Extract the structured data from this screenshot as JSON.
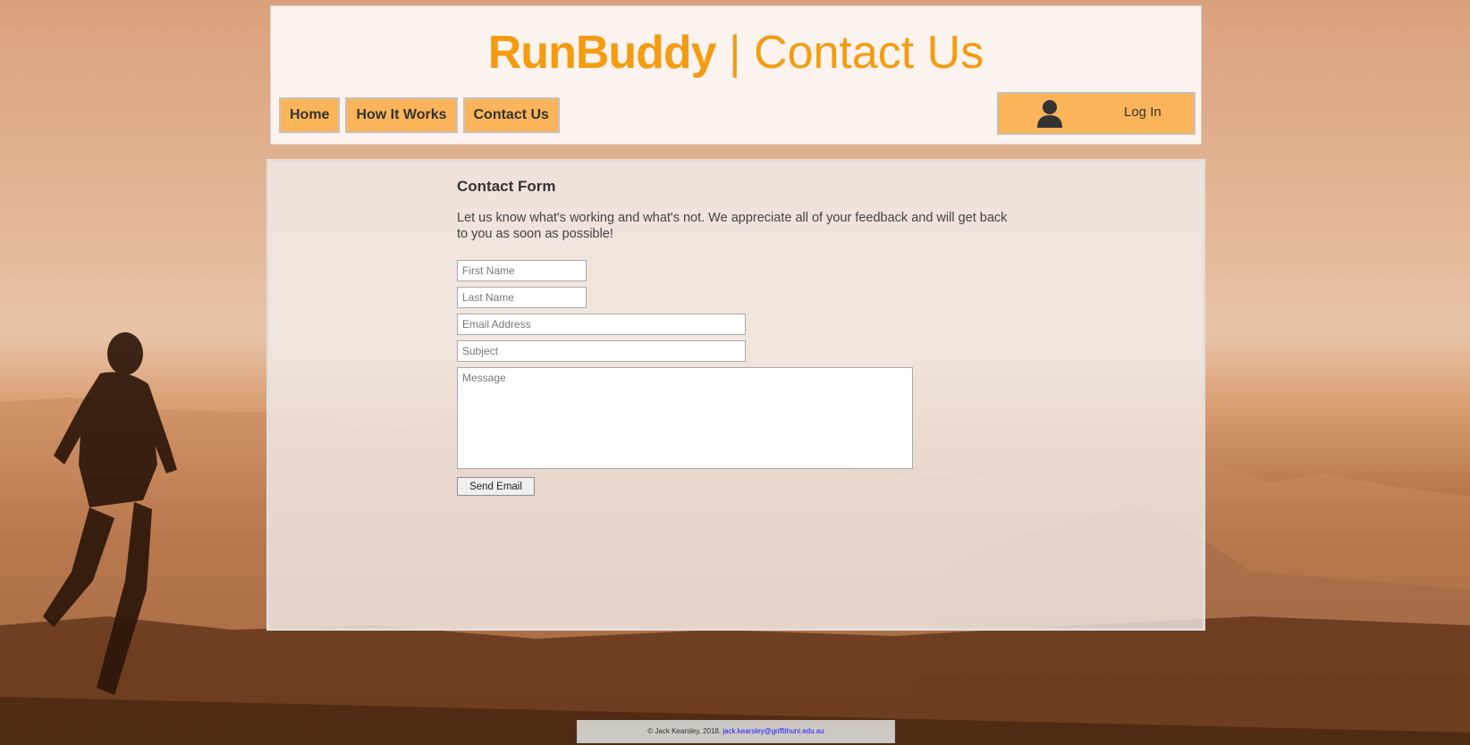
{
  "header": {
    "brand_name": "RunBuddy",
    "separator": "|",
    "page_title": "Contact Us",
    "brand_color": "#f39c12"
  },
  "nav": {
    "items": [
      {
        "label": "Home"
      },
      {
        "label": "How It Works"
      },
      {
        "label": "Contact Us"
      }
    ],
    "button_color": "#fbb45a"
  },
  "login": {
    "label": "Log In",
    "icon": "user-icon"
  },
  "contact_form": {
    "title": "Contact Form",
    "intro": "Let us know what's working and what's not. We appreciate all of your feedback and will get back to you as soon as possible!",
    "first_name_placeholder": "First Name",
    "last_name_placeholder": "Last Name",
    "email_placeholder": "Email Address",
    "subject_placeholder": "Subject",
    "message_placeholder": "Message",
    "send_label": "Send Email"
  },
  "footer": {
    "copyright": "© Jack Kearsley, 2018.",
    "email_link": "jack.kearsley@griffithuni.edu.au"
  }
}
